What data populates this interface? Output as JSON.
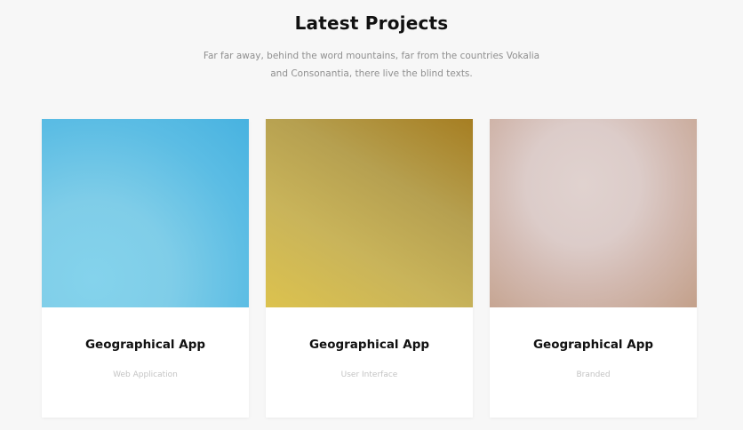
{
  "section": {
    "title": "Latest Projects",
    "subtitle": "Far far away, behind the word mountains, far from the countries Vokalia and Consonantia, there live the blind texts."
  },
  "projects": [
    {
      "title": "Geographical App",
      "category": "Web Application"
    },
    {
      "title": "Geographical App",
      "category": "User Interface"
    },
    {
      "title": "Geographical App",
      "category": "Branded"
    }
  ],
  "colors": {
    "background": "#f7f7f7",
    "card_1_image": "#7fcde8",
    "card_2_image": "#c9b45a",
    "card_3_image": "#dcccc9"
  }
}
